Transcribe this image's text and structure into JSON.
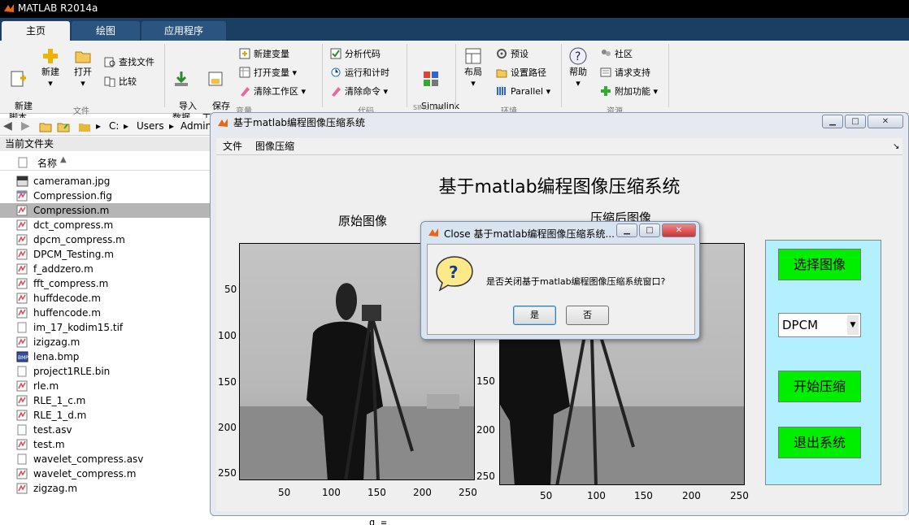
{
  "app": {
    "title": "MATLAB R2014a"
  },
  "ribbon_tabs": [
    {
      "label": "主页"
    },
    {
      "label": "绘图"
    },
    {
      "label": "应用程序"
    }
  ],
  "ribbon": {
    "new_script": "新建\n脚本",
    "new": "新建",
    "open": "打开",
    "find_files": "查找文件",
    "compare": "比较",
    "group_file": "文件",
    "import_data": "导入\n数据",
    "save_workspace": "保存\n工作区",
    "new_variable": "新建变量",
    "open_variable": "打开变量",
    "clear_workspace": "清除工作区",
    "group_variable": "变量",
    "analyze_code": "分析代码",
    "run_and_time": "运行和计时",
    "clear_commands": "清除命令",
    "group_code": "代码",
    "simulink": "Simulink\n库",
    "group_simulink": "SIMULINK",
    "layout": "布局",
    "preferences": "预设",
    "set_path": "设置路径",
    "parallel": "Parallel",
    "group_env": "环境",
    "help": "帮助",
    "community": "社区",
    "request_support": "请求支持",
    "addons": "附加功能",
    "group_resources": "资源"
  },
  "path": {
    "segments": [
      "C:",
      "Users",
      "Admin"
    ]
  },
  "current_folder": {
    "title": "当前文件夹",
    "column_name": "名称",
    "files": [
      {
        "name": "cameraman.jpg",
        "type": "jpg"
      },
      {
        "name": "Compression.fig",
        "type": "fig"
      },
      {
        "name": "Compression.m",
        "type": "m",
        "selected": true
      },
      {
        "name": "dct_compress.m",
        "type": "m"
      },
      {
        "name": "dpcm_compress.m",
        "type": "m"
      },
      {
        "name": "DPCM_Testing.m",
        "type": "m"
      },
      {
        "name": "f_addzero.m",
        "type": "m"
      },
      {
        "name": "fft_compress.m",
        "type": "m"
      },
      {
        "name": "huffdecode.m",
        "type": "m"
      },
      {
        "name": "huffencode.m",
        "type": "m"
      },
      {
        "name": "im_17_kodim15.tif",
        "type": "blank"
      },
      {
        "name": "izigzag.m",
        "type": "m"
      },
      {
        "name": "lena.bmp",
        "type": "bmp"
      },
      {
        "name": "project1RLE.bin",
        "type": "blank"
      },
      {
        "name": "rle.m",
        "type": "m"
      },
      {
        "name": "RLE_1_c.m",
        "type": "m"
      },
      {
        "name": "RLE_1_d.m",
        "type": "m"
      },
      {
        "name": "test.asv",
        "type": "blank"
      },
      {
        "name": "test.m",
        "type": "m"
      },
      {
        "name": "wavelet_compress.asv",
        "type": "blank"
      },
      {
        "name": "wavelet_compress.m",
        "type": "m"
      },
      {
        "name": "zigzag.m",
        "type": "m"
      }
    ]
  },
  "figure": {
    "title": "基于matlab编程图像压缩系统",
    "menu": [
      "文件",
      "图像压缩"
    ],
    "heading": "基于matlab编程图像压缩系统",
    "original_label": "原始图像",
    "compressed_label": "压缩后图像",
    "yticks_left": [
      "50",
      "100",
      "150",
      "200",
      "250"
    ],
    "yticks_right": [
      "150",
      "200",
      "250"
    ],
    "xticks": [
      "50",
      "100",
      "150",
      "200",
      "250"
    ],
    "buttons": {
      "select": "选择图像",
      "start": "开始压缩",
      "exit": "退出系统"
    },
    "method_select": {
      "value": "DPCM"
    }
  },
  "dialog": {
    "title": "Close 基于matlab编程图像压缩系统...",
    "message": "是否关闭基于matlab编程图像压缩系统窗口?",
    "yes": "是",
    "no": "否"
  },
  "command_window": {
    "text": "g ="
  },
  "colors": {
    "green_button": "#00ee00",
    "panel_bg": "#b3f0ff",
    "ribbon_dark": "#1b3e63"
  }
}
